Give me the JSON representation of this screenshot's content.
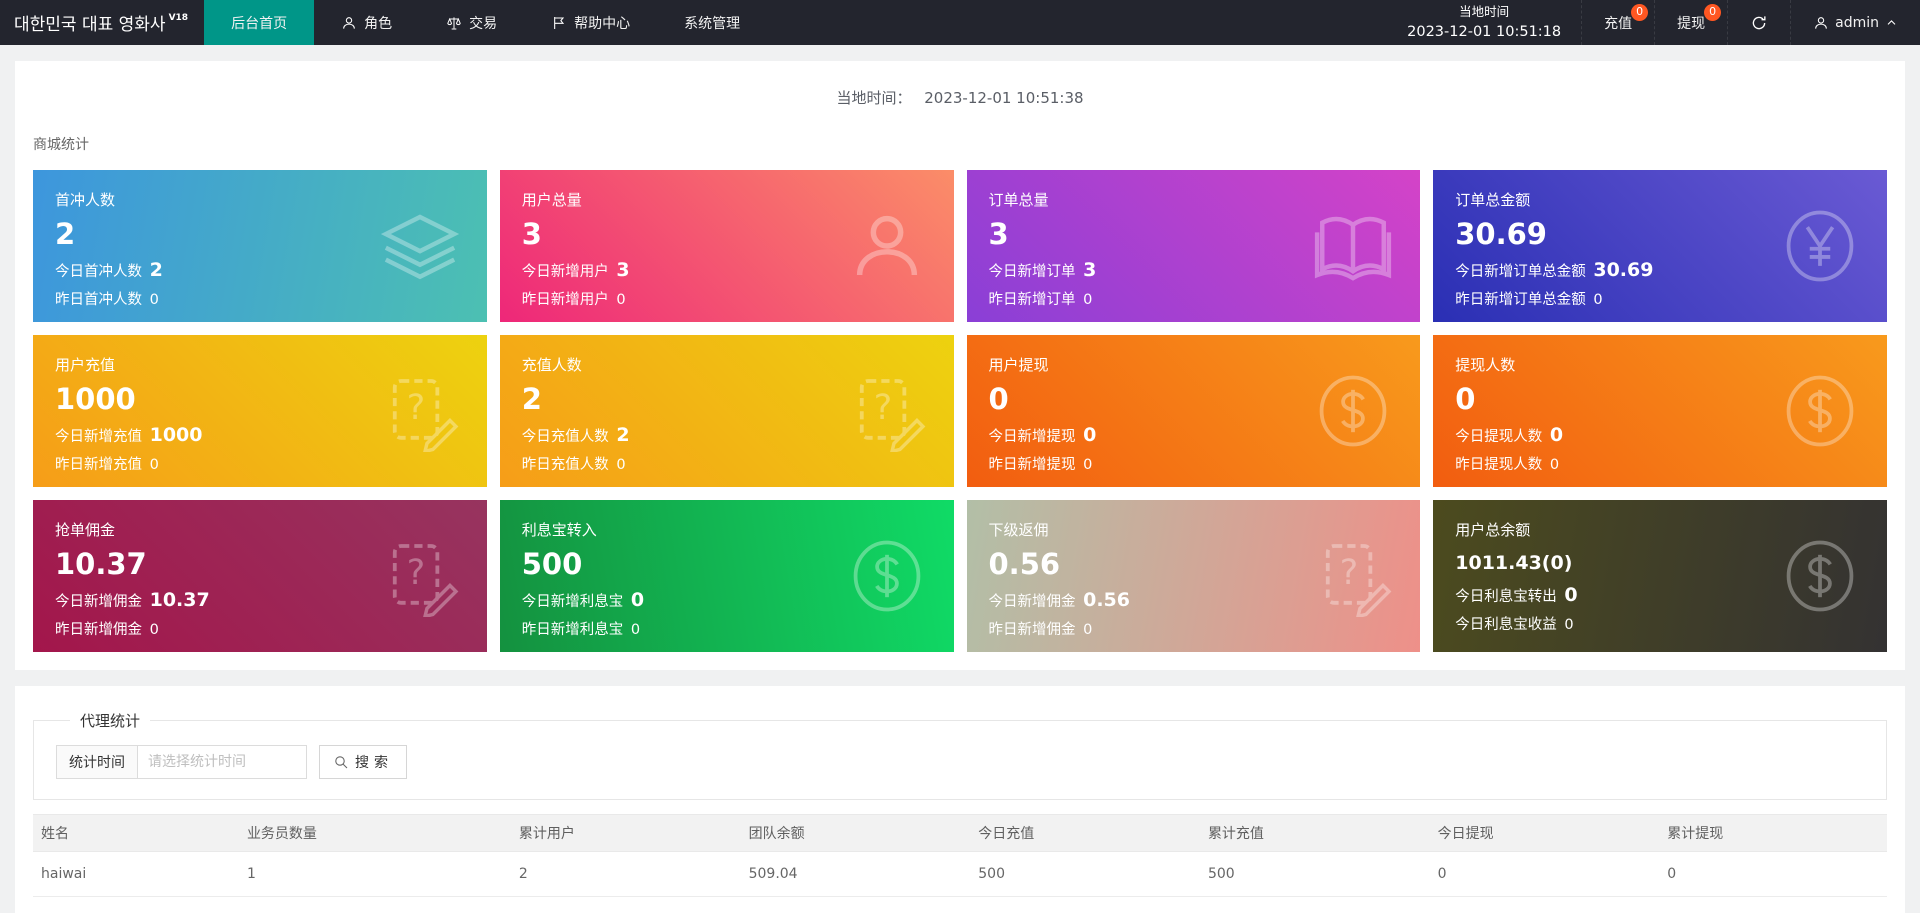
{
  "topbar": {
    "logo": "대한민국 대표 영화사",
    "logo_version": "V18",
    "nav": [
      {
        "label": "后台首页"
      },
      {
        "label": "角色"
      },
      {
        "label": "交易"
      },
      {
        "label": "帮助中心"
      },
      {
        "label": "系统管理"
      }
    ],
    "local_time_label": "当地时间",
    "local_time_value": "2023-12-01 10:51:18",
    "recharge": {
      "label": "充值",
      "badge": "0"
    },
    "withdraw": {
      "label": "提现",
      "badge": "0"
    },
    "user": "admin",
    "badge_color": "#ff5722",
    "active_tab_color": "#009688",
    "bar_color": "#23252e"
  },
  "main": {
    "time_line": {
      "label": "当地时间：",
      "value": "2023-12-01 10:51:38"
    },
    "section_title": "商城统计",
    "cards": [
      {
        "key": "first-recharge-users",
        "title": "首冲人数",
        "value": "2",
        "line1_label": "今日首冲人数",
        "line1_value": "2",
        "line2_label": "昨日首冲人数",
        "line2_value": "0",
        "icon": "layers",
        "angle": "100deg",
        "colors": [
          "#3d96dd",
          "#4cc0b2"
        ]
      },
      {
        "key": "total-users",
        "title": "用户总量",
        "value": "3",
        "line1_label": "今日新增用户",
        "line1_value": "3",
        "line2_label": "昨日新增用户",
        "line2_value": "0",
        "icon": "user",
        "angle": "45deg",
        "colors": [
          "#ee2779",
          "#fb8d68"
        ]
      },
      {
        "key": "total-orders",
        "title": "订单总量",
        "value": "3",
        "line1_label": "今日新增订单",
        "line1_value": "3",
        "line2_label": "昨日新增订单",
        "line2_value": "0",
        "icon": "book",
        "angle": "45deg",
        "colors": [
          "#8a3fd6",
          "#d443c8"
        ]
      },
      {
        "key": "order-total-amount",
        "title": "订单总金额",
        "value": "30.69",
        "line1_label": "今日新增订单总金额",
        "line1_value": "30.69",
        "line2_label": "昨日新增订单总金额",
        "line2_value": "0",
        "icon": "yen",
        "angle": "45deg",
        "colors": [
          "#2a2fb4",
          "#6a5ad4"
        ]
      },
      {
        "key": "user-recharge",
        "title": "用户充值",
        "value": "1000",
        "line1_label": "今日新增充值",
        "line1_value": "1000",
        "line2_label": "昨日新增充值",
        "line2_value": "0",
        "icon": "edit",
        "angle": "45deg",
        "colors": [
          "#f69d18",
          "#edd20f"
        ]
      },
      {
        "key": "recharge-users",
        "title": "充值人数",
        "value": "2",
        "line1_label": "今日充值人数",
        "line1_value": "2",
        "line2_label": "昨日充值人数",
        "line2_value": "0",
        "icon": "edit",
        "angle": "45deg",
        "colors": [
          "#f69d18",
          "#edd20f"
        ]
      },
      {
        "key": "user-withdraw",
        "title": "用户提现",
        "value": "0",
        "line1_label": "今日新增提现",
        "line1_value": "0",
        "line2_label": "昨日新增提现",
        "line2_value": "0",
        "icon": "dollar",
        "angle": "45deg",
        "colors": [
          "#f25d10",
          "#f89a1c"
        ]
      },
      {
        "key": "withdraw-users",
        "title": "提现人数",
        "value": "0",
        "line1_label": "今日提现人数",
        "line1_value": "0",
        "line2_label": "昨日提现人数",
        "line2_value": "0",
        "icon": "dollar",
        "angle": "45deg",
        "colors": [
          "#f25d10",
          "#f89a1c"
        ]
      },
      {
        "key": "order-commission",
        "title": "抢单佣金",
        "value": "10.37",
        "line1_label": "今日新增佣金",
        "line1_value": "10.37",
        "line2_label": "昨日新增佣金",
        "line2_value": "0",
        "icon": "edit",
        "angle": "45deg",
        "colors": [
          "#a3164b",
          "#97345f"
        ]
      },
      {
        "key": "interest-transfer-in",
        "title": "利息宝转入",
        "value": "500",
        "line1_label": "今日新增利息宝",
        "line1_value": "0",
        "line2_label": "昨日新增利息宝",
        "line2_value": "0",
        "icon": "dollar",
        "angle": "80deg",
        "colors": [
          "#14913f",
          "#10db66"
        ]
      },
      {
        "key": "sub-commission",
        "title": "下级返佣",
        "value": "0.56",
        "line1_label": "今日新增佣金",
        "line1_value": "0.56",
        "line2_label": "昨日新增佣金",
        "line2_value": "0",
        "icon": "edit",
        "angle": "100deg",
        "colors": [
          "#b2bfa7",
          "#ee9089"
        ]
      },
      {
        "key": "user-total-balance",
        "title": "用户总余额",
        "value": "1011.43(0)",
        "line1_label": "今日利息宝转出",
        "line1_value": "0",
        "line2_label": "今日利息宝收益",
        "line2_value": "0",
        "icon": "dollar",
        "angle": "100deg",
        "colors": [
          "#4c4b1e",
          "#343232"
        ]
      }
    ]
  },
  "agent": {
    "legend": "代理统计",
    "filter_label": "统计时间",
    "placeholder": "请选择统计时间",
    "search_label": "搜索",
    "table": {
      "headers": [
        "姓名",
        "业务员数量",
        "累计用户",
        "团队余额",
        "今日充值",
        "累计充值",
        "今日提现",
        "累计提现"
      ],
      "rows": [
        [
          "haiwai",
          "1",
          "2",
          "509.04",
          "500",
          "500",
          "0",
          "0"
        ]
      ]
    }
  }
}
